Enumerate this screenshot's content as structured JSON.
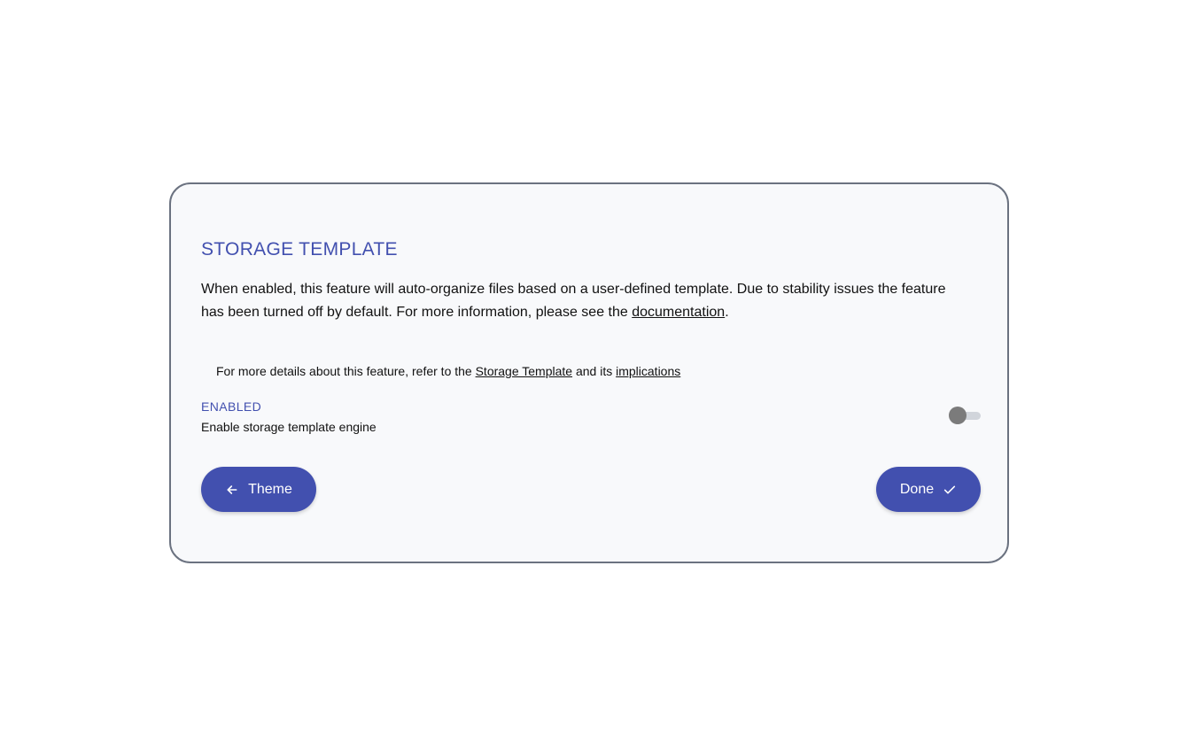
{
  "card": {
    "title": "STORAGE TEMPLATE",
    "description_text": "When enabled, this feature will auto-organize files based on a user-defined template. Due to stability issues the feature has been turned off by default. For more information, please see the ",
    "description_link": "documentation",
    "description_end": ".",
    "details_prefix": "For more details about this feature, refer to the ",
    "details_link_template": "Storage Template",
    "details_middle": " and its ",
    "details_link_implications": "implications"
  },
  "setting": {
    "label": "ENABLED",
    "subtitle": "Enable storage template engine",
    "enabled": false
  },
  "buttons": {
    "back_label": "Theme",
    "back_icon": "arrow-left-icon",
    "done_label": "Done",
    "done_icon": "check-icon"
  },
  "colors": {
    "accent": "#4250af",
    "toggle_off_thumb": "#7b7b7b",
    "toggle_off_track": "#d1d5db",
    "card_border": "#6b7280",
    "card_background": "#f8f9fb"
  }
}
